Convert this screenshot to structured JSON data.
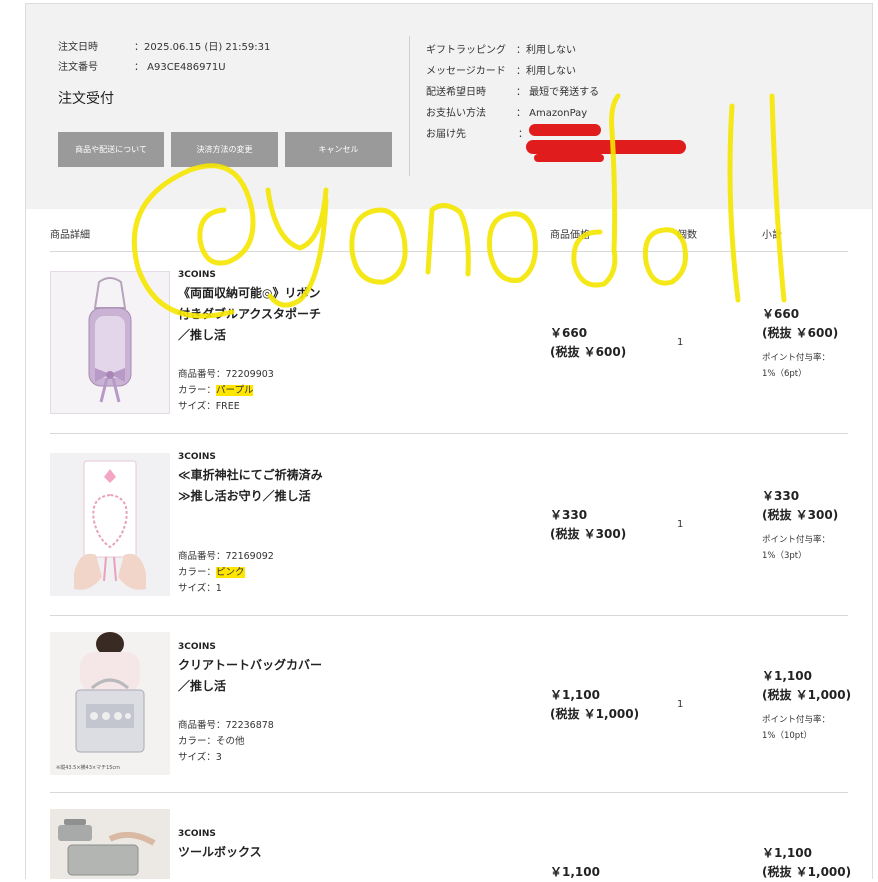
{
  "order": {
    "date_label": "注文日時",
    "date_value": "：2025.06.15 (日) 21:59:31",
    "number_label": "注文番号",
    "number_value": "：  A93CE486971U",
    "status": "注文受付",
    "buttons": [
      "商品や配送について",
      "決済方法の変更",
      "キャンセル"
    ]
  },
  "details": {
    "gift_label": "ギフトラッピング",
    "gift_value": "：利用しない",
    "message_label": "メッセージカード",
    "message_value": "：利用しない",
    "delivery_label": "配送希望日時",
    "delivery_value": "：  最短で発送する",
    "payment_label": "お支払い方法",
    "payment_value": "：  AmazonPay",
    "address_label": "お届け先",
    "address_value": "："
  },
  "columns": {
    "detail": "商品詳細",
    "price": "商品価格",
    "qty": "個数",
    "subtotal": "小計"
  },
  "items": [
    {
      "brand": "3COINS",
      "name": "《両面収納可能◎》リボン付きダブルアクスタポーチ／推し活",
      "code": "商品番号：72209903",
      "color_label": "カラー：",
      "color_value": "パープル",
      "size": "サイズ：FREE",
      "price": "￥660",
      "price_tax": "(税抜 ￥600)",
      "qty": "1",
      "subtotal": "￥660",
      "subtotal_tax": "(税抜 ￥600)",
      "points_label": "ポイント付与率：",
      "points_value": "1%（6pt）"
    },
    {
      "brand": "3COINS",
      "name": "≪車折神社にてご祈祷済み≫推し活お守り／推し活",
      "code": "商品番号：72169092",
      "color_label": "カラー：",
      "color_value": "ピンク",
      "size": "サイズ：1",
      "price": "￥330",
      "price_tax": "(税抜 ￥300)",
      "qty": "1",
      "subtotal": "￥330",
      "subtotal_tax": "(税抜 ￥300)",
      "points_label": "ポイント付与率：",
      "points_value": "1%（3pt）"
    },
    {
      "brand": "3COINS",
      "name": "クリアトートバッグカバー／推し活",
      "code": "商品番号：72236878",
      "color_label": "カラー：",
      "color_value": "その他",
      "size": "サイズ：3",
      "price": "￥1,100",
      "price_tax": "(税抜 ￥1,000)",
      "qty": "1",
      "subtotal": "￥1,100",
      "subtotal_tax": "(税抜 ￥1,000)",
      "points_label": "ポイント付与率：",
      "points_value": "1%（10pt）",
      "image_caption": "※縦43.5×横43×マチ15cm"
    },
    {
      "brand": "3COINS",
      "name": "ツールボックス",
      "price": "￥1,100",
      "subtotal": "￥1,100",
      "subtotal_tax": "(税抜 ￥1,000)"
    }
  ],
  "watermark": "@yonodoll",
  "colors": {
    "summary_bg": "#f2f2f2",
    "button_bg": "#9a9a9a",
    "highlight": "#ffe600",
    "redaction": "#e11c1c"
  }
}
